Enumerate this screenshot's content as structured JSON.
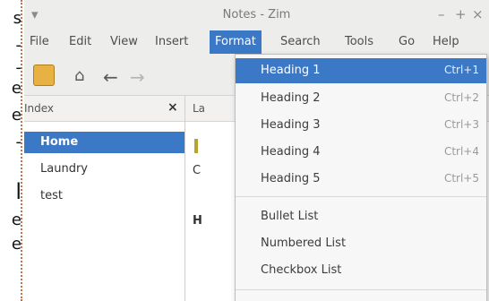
{
  "left_strip": {
    "glyphs": [
      "s",
      "-",
      "-",
      "e",
      "e",
      "-",
      "l",
      "e",
      "e"
    ]
  },
  "window": {
    "title": "Notes - Zim",
    "controls": {
      "menu": "▾",
      "minimize": "–",
      "maximize": "+",
      "close": "×"
    }
  },
  "menubar": {
    "items": [
      "File",
      "Edit",
      "View",
      "Insert",
      "Format",
      "Search",
      "Tools",
      "Go",
      "Help"
    ],
    "active": "Format"
  },
  "toolbar": {
    "icons": [
      "zim-notebook-icon",
      "home-icon",
      "back-arrow-icon",
      "forward-arrow-icon"
    ]
  },
  "index_panel": {
    "header": "Index",
    "close_glyph": "×",
    "items": [
      {
        "label": "Home",
        "selected": true
      },
      {
        "label": "Laundry",
        "selected": false
      },
      {
        "label": "test",
        "selected": false
      }
    ]
  },
  "page": {
    "tab_label": "La",
    "partial_chars": [
      "C",
      "H"
    ]
  },
  "format_menu": {
    "items": [
      {
        "label": "Heading 1",
        "accel": "Ctrl+1",
        "highlighted": true
      },
      {
        "label": "Heading 2",
        "accel": "Ctrl+2"
      },
      {
        "label": "Heading 3",
        "accel": "Ctrl+3"
      },
      {
        "label": "Heading 4",
        "accel": "Ctrl+4"
      },
      {
        "label": "Heading 5",
        "accel": "Ctrl+5"
      },
      {
        "label": "Bullet List",
        "accel": ""
      },
      {
        "label": "Numbered List",
        "accel": ""
      },
      {
        "label": "Checkbox List",
        "accel": ""
      }
    ]
  },
  "colors": {
    "accent": "#3b79c6",
    "window_bg": "#f2f1f0",
    "menu_bg": "#f7f7f7"
  }
}
